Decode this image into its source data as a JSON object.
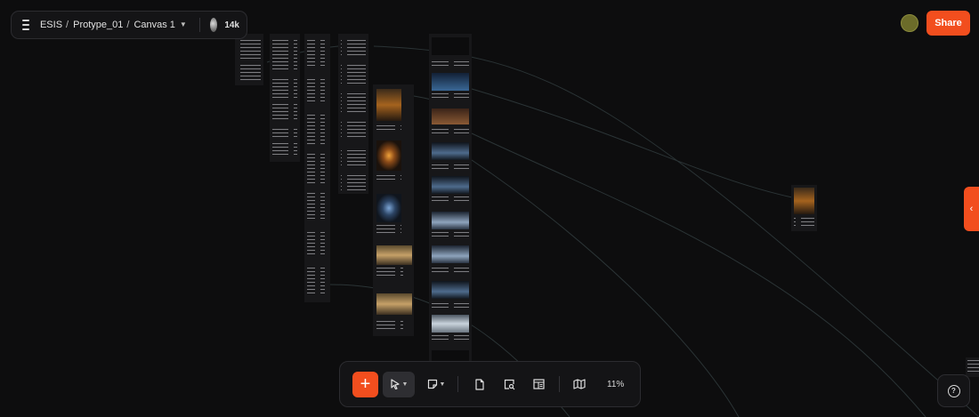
{
  "breadcrumb": {
    "workspace": "ESIS",
    "project": "Protype_01",
    "canvas": "Canvas 1"
  },
  "collaborators": {
    "count": "14k"
  },
  "share_label": "Share",
  "zoom_level": "11%",
  "colors": {
    "accent": "#f24e1e",
    "background": "#0d0d0e",
    "panel": "#141416"
  },
  "icons": {
    "menu": "hamburger-menu-icon",
    "chevron": "chevron-down-icon",
    "side_tab": "chevron-left-icon",
    "add": "plus-icon",
    "select": "pointer-cursor-icon",
    "note": "sticky-note-icon",
    "doc": "document-icon",
    "image_search": "image-search-icon",
    "layout": "layout-template-icon",
    "map": "map-icon",
    "help": "help-circle-icon"
  }
}
